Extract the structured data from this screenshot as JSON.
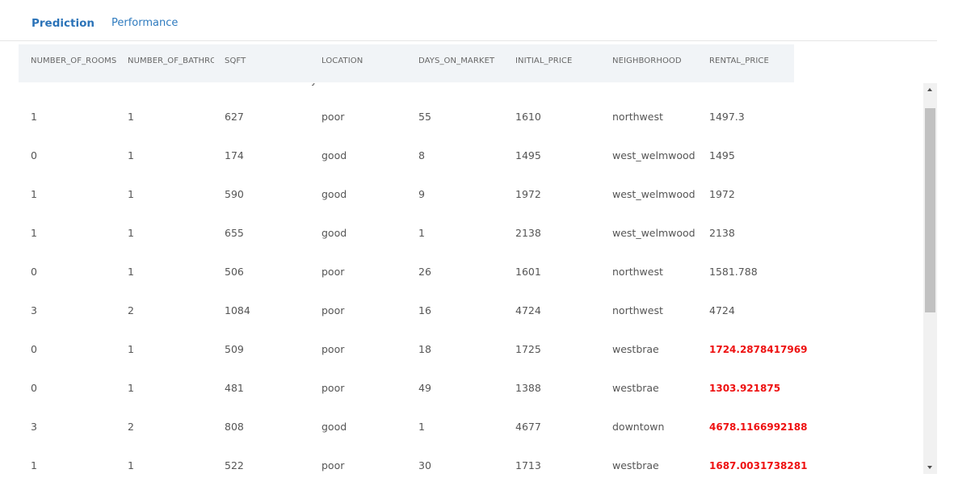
{
  "tabs": [
    {
      "label": "Prediction",
      "active": true
    },
    {
      "label": "Performance",
      "active": false
    }
  ],
  "table": {
    "columns": [
      "NUMBER_OF_ROOMS",
      "NUMBER_OF_BATHRO",
      "SQFT",
      "LOCATION",
      "DAYS_ON_MARKET",
      "INITIAL_PRICE",
      "NEIGHBORHOOD",
      "RENTAL_PRICE"
    ],
    "rows": [
      {
        "number_of_rooms": "1",
        "number_of_bathrooms": "1",
        "sqft": "627",
        "location": "poor",
        "days_on_market": "55",
        "initial_price": "1610",
        "neighborhood": "northwest",
        "rental_price": "1497.3",
        "flag": false
      },
      {
        "number_of_rooms": "0",
        "number_of_bathrooms": "1",
        "sqft": "174",
        "location": "good",
        "days_on_market": "8",
        "initial_price": "1495",
        "neighborhood": "west_welmwood",
        "rental_price": "1495",
        "flag": false
      },
      {
        "number_of_rooms": "1",
        "number_of_bathrooms": "1",
        "sqft": "590",
        "location": "good",
        "days_on_market": "9",
        "initial_price": "1972",
        "neighborhood": "west_welmwood",
        "rental_price": "1972",
        "flag": false
      },
      {
        "number_of_rooms": "1",
        "number_of_bathrooms": "1",
        "sqft": "655",
        "location": "good",
        "days_on_market": "1",
        "initial_price": "2138",
        "neighborhood": "west_welmwood",
        "rental_price": "2138",
        "flag": false
      },
      {
        "number_of_rooms": "0",
        "number_of_bathrooms": "1",
        "sqft": "506",
        "location": "poor",
        "days_on_market": "26",
        "initial_price": "1601",
        "neighborhood": "northwest",
        "rental_price": "1581.788",
        "flag": false
      },
      {
        "number_of_rooms": "3",
        "number_of_bathrooms": "2",
        "sqft": "1084",
        "location": "poor",
        "days_on_market": "16",
        "initial_price": "4724",
        "neighborhood": "northwest",
        "rental_price": "4724",
        "flag": false
      },
      {
        "number_of_rooms": "0",
        "number_of_bathrooms": "1",
        "sqft": "509",
        "location": "poor",
        "days_on_market": "18",
        "initial_price": "1725",
        "neighborhood": "westbrae",
        "rental_price": "1724.2878417969",
        "flag": true
      },
      {
        "number_of_rooms": "0",
        "number_of_bathrooms": "1",
        "sqft": "481",
        "location": "poor",
        "days_on_market": "49",
        "initial_price": "1388",
        "neighborhood": "westbrae",
        "rental_price": "1303.921875",
        "flag": true
      },
      {
        "number_of_rooms": "3",
        "number_of_bathrooms": "2",
        "sqft": "808",
        "location": "good",
        "days_on_market": "1",
        "initial_price": "4677",
        "neighborhood": "downtown",
        "rental_price": "4678.1166992188",
        "flag": true
      },
      {
        "number_of_rooms": "1",
        "number_of_bathrooms": "1",
        "sqft": "522",
        "location": "poor",
        "days_on_market": "30",
        "initial_price": "1713",
        "neighborhood": "westbrae",
        "rental_price": "1687.0031738281",
        "flag": true
      }
    ]
  },
  "partial_row_text": "y",
  "colors": {
    "accent": "#2f7bbf",
    "flag": "#ee1111",
    "header_bg": "#f1f4f7"
  }
}
